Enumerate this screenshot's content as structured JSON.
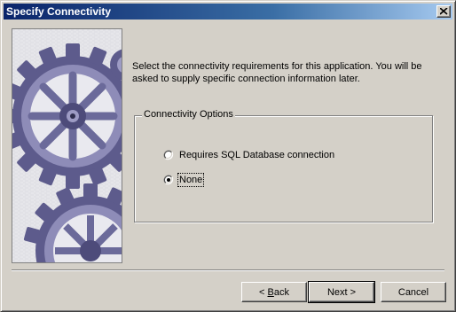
{
  "window": {
    "title": "Specify Connectivity",
    "close_label": "×"
  },
  "intro": {
    "text": "Select the connectivity requirements for this application.  You will be\nasked to supply specific connection information later."
  },
  "connectivity_options": {
    "legend": "Connectivity Options",
    "options": [
      {
        "label": "Requires SQL Database connection",
        "selected": false
      },
      {
        "label": "None",
        "selected": true
      }
    ]
  },
  "buttons": {
    "back_prefix": "< ",
    "back_mnemonic": "B",
    "back_rest": "ack",
    "next": "Next >",
    "cancel": "Cancel"
  },
  "icons": {
    "close": "close-icon",
    "wizard_graphic": "gears-illustration"
  },
  "colors": {
    "title_start": "#0a246a",
    "title_end": "#a6caf0",
    "dialog_face": "#d4d0c8",
    "gear_purple": "#6b6a9a"
  }
}
